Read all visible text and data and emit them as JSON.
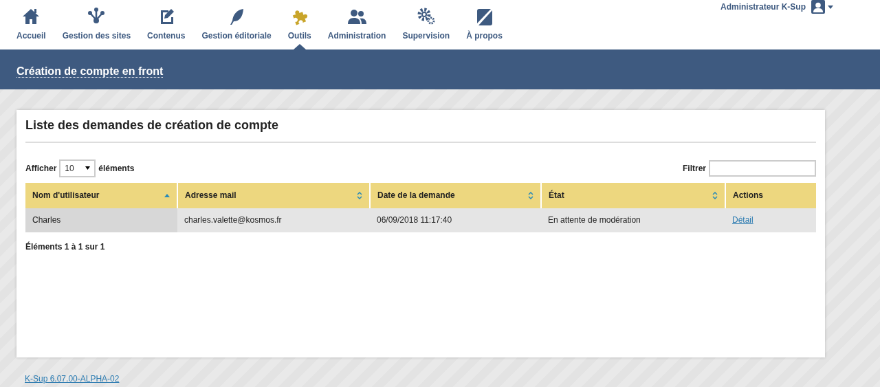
{
  "nav": [
    {
      "label": "Accueil",
      "selected": false
    },
    {
      "label": "Gestion des sites",
      "selected": false
    },
    {
      "label": "Contenus",
      "selected": false
    },
    {
      "label": "Gestion éditoriale",
      "selected": false
    },
    {
      "label": "Outils",
      "selected": true
    },
    {
      "label": "Administration",
      "selected": false
    },
    {
      "label": "Supervision",
      "selected": false
    },
    {
      "label": "À propos",
      "selected": false
    }
  ],
  "user": {
    "name": "Administrateur K-Sup"
  },
  "page_title": "Création de compte en front",
  "panel": {
    "title": "Liste des demandes de création de compte",
    "length": {
      "before": "Afficher",
      "value": "10",
      "after": "éléments"
    },
    "filter": {
      "label": "Filtrer"
    },
    "table": {
      "columns": [
        {
          "label": "Nom d'utilisateur",
          "sorted": true
        },
        {
          "label": "Adresse mail",
          "sortable": true,
          "sorted": false
        },
        {
          "label": "Date de la demande",
          "sortable": true,
          "sorted": false
        },
        {
          "label": "État",
          "sortable": true,
          "sorted": false
        },
        {
          "label": "Actions",
          "sortable": false
        }
      ],
      "rows": [
        {
          "cells": [
            "Charles",
            "charles.valette@kosmos.fr",
            "06/09/2018 11:17:40",
            "En attente de modération"
          ],
          "action": "Détail"
        }
      ]
    },
    "info": "Éléments **1** à **1** sur **1**"
  },
  "footer": {
    "version": "K-Sup 6.07.00-ALPHA-02"
  }
}
